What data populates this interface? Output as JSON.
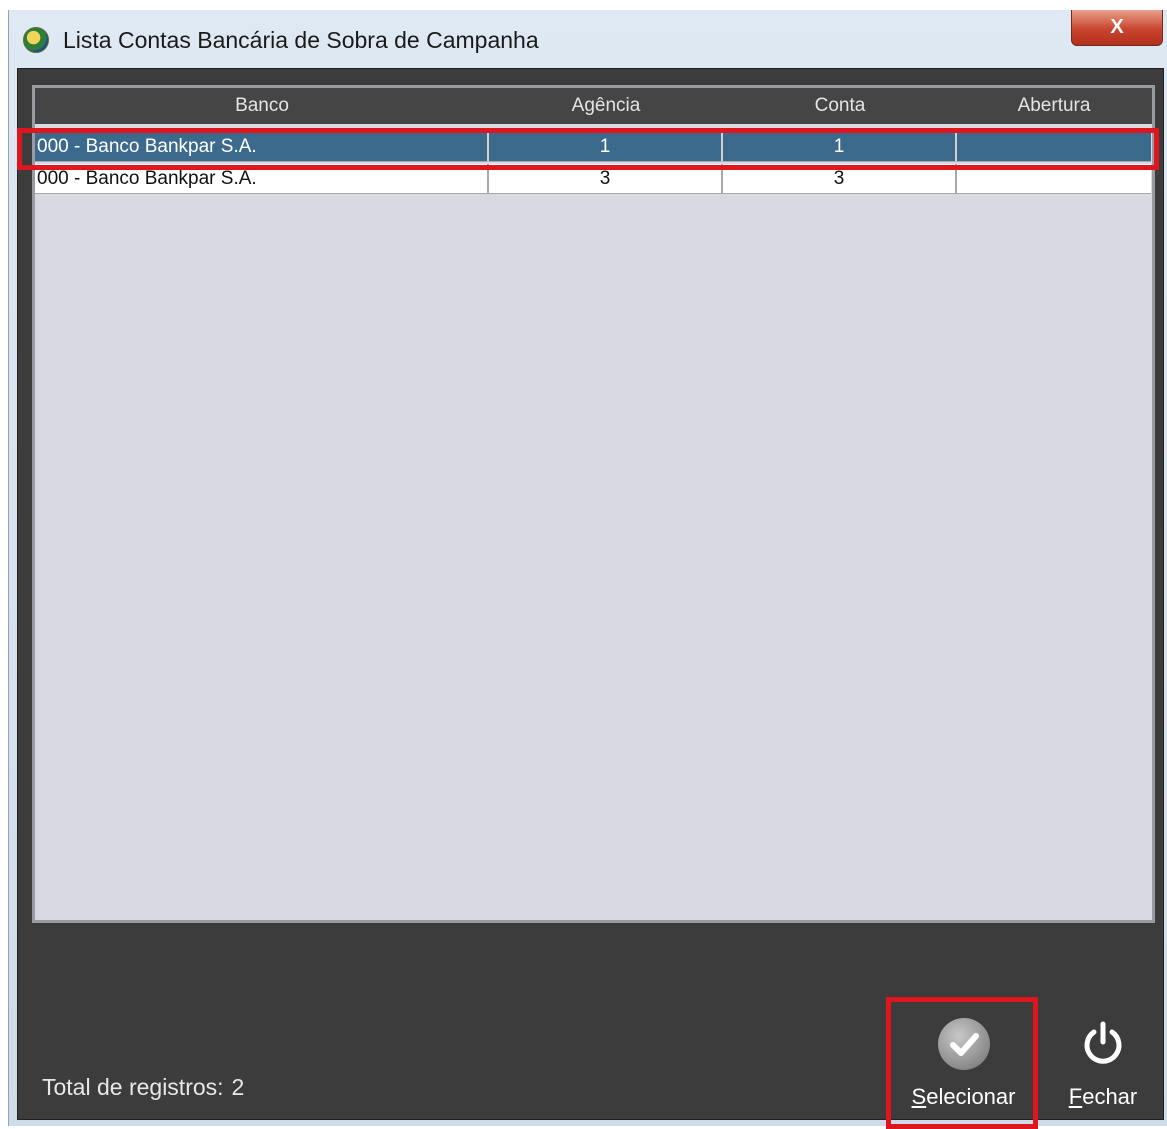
{
  "window": {
    "title": "Lista Contas Bancária de Sobra de Campanha",
    "close_label": "X"
  },
  "grid": {
    "columns": [
      "Banco",
      "Agência",
      "Conta",
      "Abertura"
    ],
    "rows": [
      {
        "banco": "000 - Banco Bankpar S.A.",
        "agencia": "1",
        "conta": "1",
        "abertura": "",
        "selected": true
      },
      {
        "banco": "000 - Banco Bankpar S.A.",
        "agencia": "3",
        "conta": "3",
        "abertura": "",
        "selected": false
      }
    ]
  },
  "status": {
    "label": "Total de registros:",
    "count": "2"
  },
  "buttons": {
    "select": {
      "mnemonic": "S",
      "rest": "elecionar",
      "icon": "check-circle-icon"
    },
    "close": {
      "mnemonic": "F",
      "rest": "echar",
      "icon": "power-icon"
    }
  },
  "colors": {
    "selected_row": "#3c6a8c",
    "highlight": "#e0161f",
    "panel_bg": "#3c3c3c"
  }
}
